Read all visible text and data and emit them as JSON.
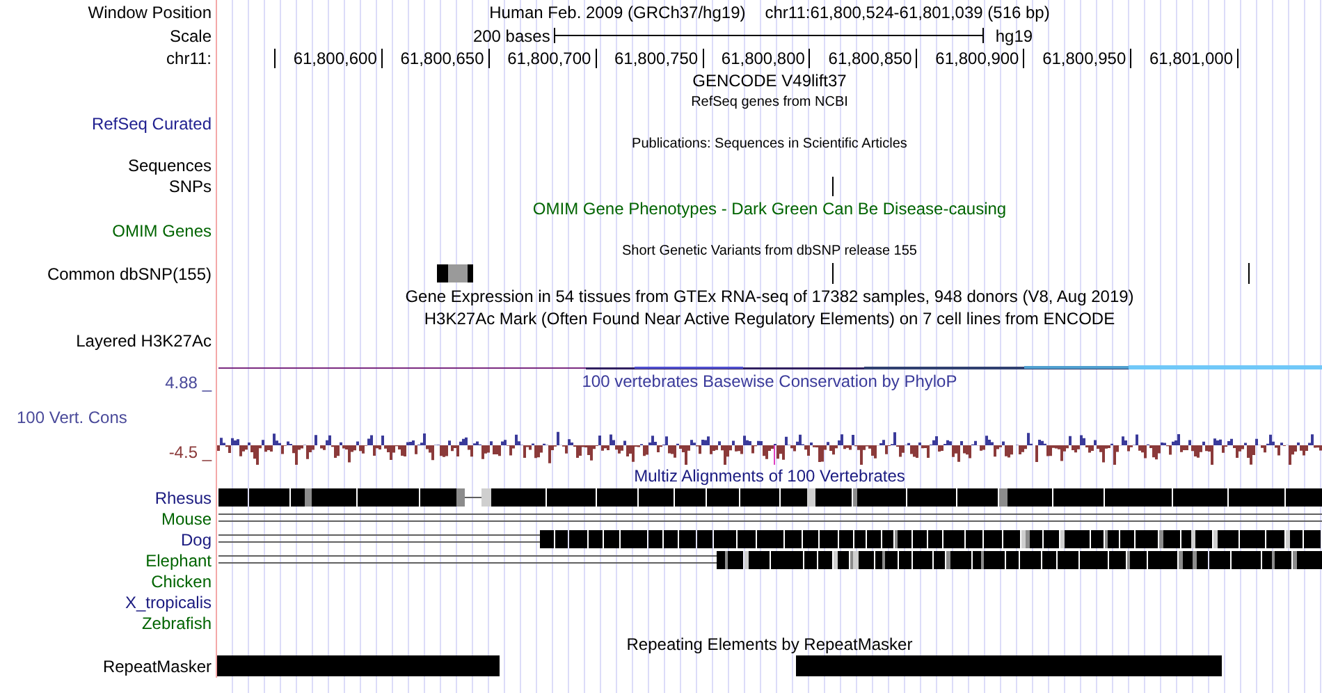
{
  "rows": [
    {
      "kind": "position",
      "label": "Window Position",
      "title": "Human Feb. 2009 (GRCh37/hg19)",
      "position": "chr11:61,800,524-61,801,039 (516 bp)"
    },
    {
      "kind": "scale",
      "label": "Scale",
      "scale_bar": "200 bases",
      "assembly": "hg19"
    },
    {
      "kind": "ruler",
      "label": "chr11:",
      "ticks": [
        "61,800,600",
        "61,800,650",
        "61,800,700",
        "61,800,750",
        "61,800,800",
        "61,800,850",
        "61,800,900",
        "61,800,950",
        "61,801,000"
      ]
    },
    {
      "kind": "title",
      "title": "GENCODE V49lift37"
    },
    {
      "kind": "note",
      "title": "RefSeq genes from NCBI"
    },
    {
      "kind": "label",
      "label": "RefSeq Curated",
      "color": "#1f1f8f"
    },
    {
      "kind": "note",
      "title": "Publications: Sequences in Scientific Articles"
    },
    {
      "kind": "label",
      "label": "Sequences"
    },
    {
      "kind": "snp_tick",
      "label": "SNPs"
    },
    {
      "kind": "title",
      "title": "OMIM Gene Phenotypes - Dark Green Can Be Disease-causing",
      "color": "#006400"
    },
    {
      "kind": "label",
      "label": "OMIM Genes",
      "color": "#006400"
    },
    {
      "kind": "note",
      "title": "Short Genetic Variants from dbSNP release 155"
    },
    {
      "kind": "dbsnp",
      "label": "Common dbSNP(155)"
    },
    {
      "kind": "title",
      "title": "Gene Expression in 54 tissues from GTEx RNA-seq of 17382 samples, 948 donors (V8, Aug 2019)"
    },
    {
      "kind": "title",
      "title": "H3K27Ac Mark (Often Found Near Active Regulatory Elements) on 7 cell lines from ENCODE"
    },
    {
      "kind": "label",
      "label": "Layered H3K27Ac"
    },
    {
      "kind": "signal_line"
    },
    {
      "kind": "conservation",
      "title": "100 vertebrates Basewise Conservation by PhyloP",
      "label": "100 Vert. Cons",
      "max_label": "4.88 _",
      "min_label": "-4.5 _"
    },
    {
      "kind": "title",
      "title": "Multiz Alignments of 100 Vertebrates",
      "color": "#1a1a80"
    },
    {
      "kind": "alignment",
      "label": "Rhesus",
      "color": "#1a1a80"
    },
    {
      "kind": "alignment",
      "label": "Mouse",
      "color": "#006400"
    },
    {
      "kind": "alignment",
      "label": "Dog",
      "color": "#1a1a80"
    },
    {
      "kind": "alignment",
      "label": "Elephant",
      "color": "#006400"
    },
    {
      "kind": "alignment",
      "label": "Chicken",
      "color": "#006400"
    },
    {
      "kind": "alignment",
      "label": "X_tropicalis",
      "color": "#1a1a80"
    },
    {
      "kind": "alignment",
      "label": "Zebrafish",
      "color": "#006400"
    },
    {
      "kind": "title",
      "title": "Repeating Elements by RepeatMasker"
    },
    {
      "kind": "repeats",
      "label": "RepeatMasker"
    }
  ]
}
